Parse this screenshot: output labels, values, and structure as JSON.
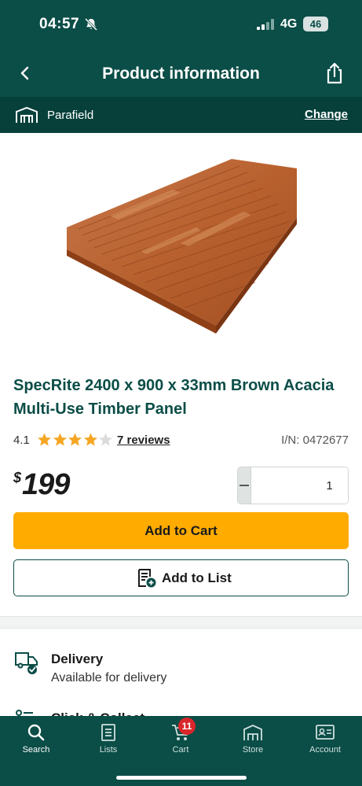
{
  "status_bar": {
    "time": "04:57",
    "network": "4G",
    "battery": "46"
  },
  "header": {
    "title": "Product information",
    "back_icon": "chevron-left-icon",
    "share_icon": "share-icon"
  },
  "store": {
    "name": "Parafield",
    "change_label": "Change",
    "icon": "store-icon"
  },
  "product": {
    "title": "SpecRite 2400 x 900 x 33mm Brown Acacia Multi-Use Timber Panel",
    "rating": "4.1",
    "rating_value": 4.1,
    "rating_max": 5,
    "reviews_label": "7 reviews",
    "item_number": "I/N: 0472677",
    "price_currency": "$",
    "price_amount": "199",
    "quantity": "1",
    "add_to_cart_label": "Add to Cart",
    "add_to_list_label": "Add to List"
  },
  "fulfilment": {
    "delivery_title": "Delivery",
    "delivery_status": "Available for delivery",
    "next_title": "Click & Collect"
  },
  "tabs": [
    {
      "label": "Search",
      "icon": "search-icon",
      "active": true
    },
    {
      "label": "Lists",
      "icon": "list-icon",
      "active": false
    },
    {
      "label": "Cart",
      "icon": "cart-icon",
      "active": false,
      "badge": "11"
    },
    {
      "label": "Store",
      "icon": "store-icon",
      "active": false
    },
    {
      "label": "Account",
      "icon": "account-icon",
      "active": false
    }
  ],
  "colors": {
    "brand": "#0b4d47",
    "cta": "#ffab00",
    "star": "#f5a623",
    "badge": "#d9262a"
  }
}
